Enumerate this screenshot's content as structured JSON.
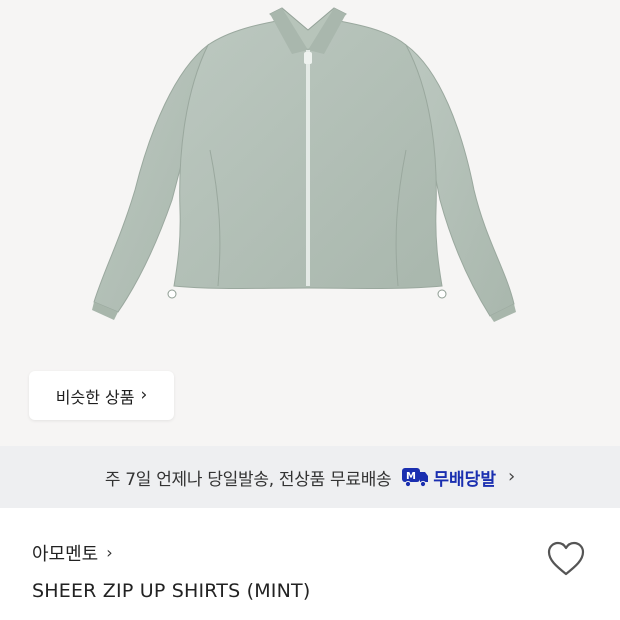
{
  "hero": {
    "image_alt": "mint sheer zip-up shirt",
    "similar_button": {
      "label": "비슷한 상품",
      "chevron": "›"
    }
  },
  "delivery": {
    "text": "주 7일 언제나 당일발송, 전상품 무료배송",
    "badge_icon": "truck-m-icon",
    "brand": "무배당발",
    "chevron": "›"
  },
  "product": {
    "brand": "아모멘토",
    "brand_chevron": "›",
    "name": "SHEER ZIP UP SHIRTS (MINT)",
    "wishlist_icon": "heart-icon"
  },
  "colors": {
    "garment": "#b4c1b8",
    "delivery_brand": "#1a2fb0",
    "background": "#f6f5f4"
  }
}
